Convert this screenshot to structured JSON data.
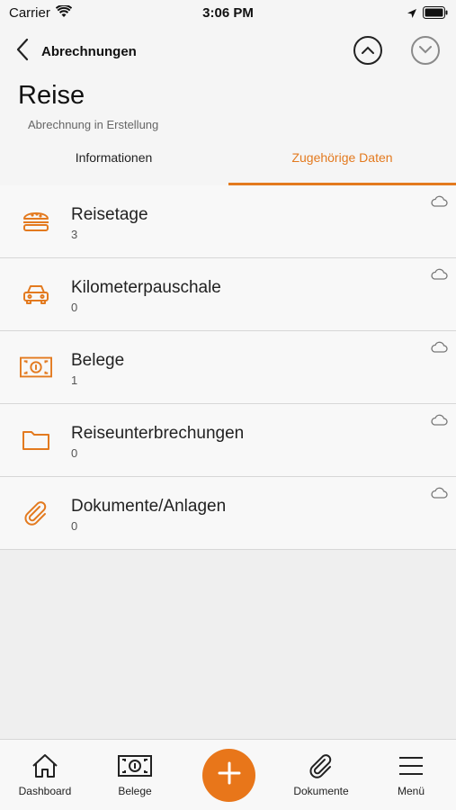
{
  "status_bar": {
    "carrier": "Carrier",
    "time": "3:06 PM"
  },
  "header": {
    "back_label": "Abrechnungen",
    "title": "Reise",
    "subtitle": "Abrechnung in Erstellung"
  },
  "tabs": [
    {
      "label": "Informationen",
      "active": false
    },
    {
      "label": "Zugehörige Daten",
      "active": true
    }
  ],
  "list": [
    {
      "title": "Reisetage",
      "count": "3",
      "icon": "burger-icon"
    },
    {
      "title": "Kilometerpauschale",
      "count": "0",
      "icon": "car-icon"
    },
    {
      "title": "Belege",
      "count": "1",
      "icon": "banknote-icon"
    },
    {
      "title": "Reiseunterbrechungen",
      "count": "0",
      "icon": "folder-icon"
    },
    {
      "title": "Dokumente/Anlagen",
      "count": "0",
      "icon": "paperclip-icon"
    }
  ],
  "tabbar": [
    {
      "label": "Dashboard",
      "icon": "home-icon"
    },
    {
      "label": "Belege",
      "icon": "banknote-icon"
    },
    {
      "label": "",
      "icon": "plus-icon"
    },
    {
      "label": "Dokumente",
      "icon": "paperclip-icon"
    },
    {
      "label": "Menü",
      "icon": "menu-icon"
    }
  ],
  "colors": {
    "accent": "#e37a1f",
    "background": "#efefef",
    "surface": "#f8f8f8"
  }
}
